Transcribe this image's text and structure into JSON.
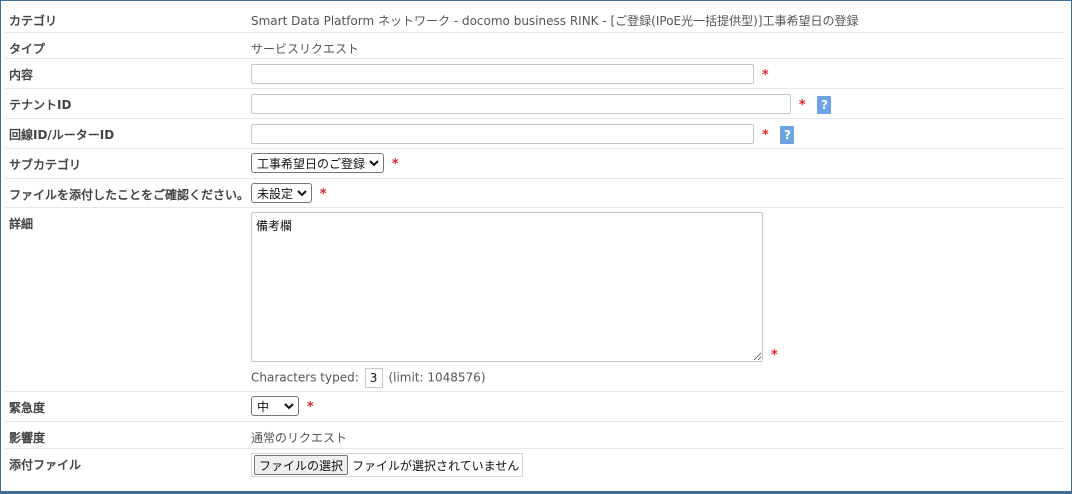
{
  "form": {
    "category": {
      "label": "カテゴリ",
      "value": "Smart Data Platform ネットワーク - docomo business RINK - [ご登録(IPoE光一括提供型)]工事希望日の登録"
    },
    "type": {
      "label": "タイプ",
      "value": "サービスリクエスト"
    },
    "content": {
      "label": "内容",
      "value": "",
      "required": "*"
    },
    "tenant_id": {
      "label": "テナントID",
      "value": "",
      "required": "*",
      "help": "?"
    },
    "line_router_id": {
      "label": "回線ID/ルーターID",
      "value": "",
      "required": "*",
      "help": "?"
    },
    "subcategory": {
      "label": "サブカテゴリ",
      "selected": "工事希望日のご登録",
      "required": "*"
    },
    "file_confirm": {
      "label": "ファイルを添付したことをご確認ください。",
      "selected": "未設定",
      "required": "*"
    },
    "details": {
      "label": "詳細",
      "value": "備考欄",
      "required": "*",
      "counter_prefix": "Characters typed:",
      "counter_value": "3",
      "counter_limit": "(limit: 1048576)"
    },
    "urgency": {
      "label": "緊急度",
      "selected": "中",
      "required": "*"
    },
    "impact": {
      "label": "影響度",
      "value": "通常のリクエスト"
    },
    "attachment": {
      "label": "添付ファイル",
      "button_label": "ファイルの選択",
      "status": "ファイルが選択されていません"
    }
  },
  "icons": {
    "dropdown": "chevron-down-icon",
    "help": "question-icon"
  }
}
